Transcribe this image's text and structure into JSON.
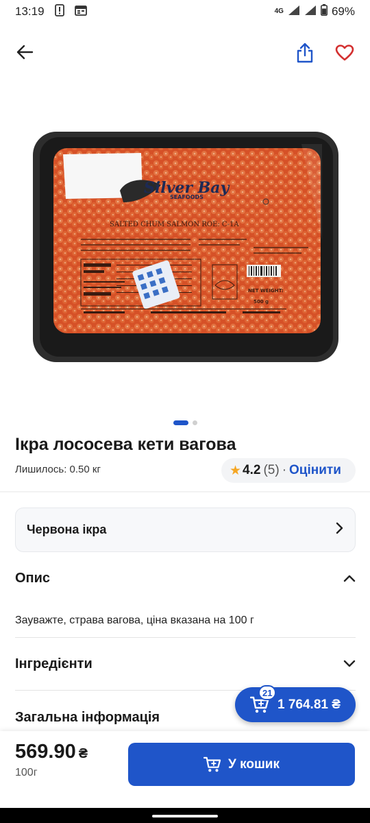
{
  "status_bar": {
    "time": "13:19",
    "network": "4G",
    "battery": "69%"
  },
  "product": {
    "title": "Ікра лососева кети вагова",
    "remaining": "Лишилось: 0.50 кг",
    "rating_score": "4.2",
    "rating_count": "(5)",
    "rating_sep": "·",
    "rate_label": "Оцінити",
    "image_slides": 2,
    "active_slide": 1
  },
  "package_label": {
    "brand": "Silver Bay",
    "brand_sub": "SEAFOODS",
    "product_line": "SALTED CHUM SALMON ROE: C-1A",
    "net_weight_label": "NET WEIGHT:",
    "net_weight": "500 g"
  },
  "category": {
    "label": "Червона ікра"
  },
  "sections": {
    "description_title": "Опис",
    "description_text": "Зауважте, страва вагова, ціна вказана на 100 г",
    "ingredients_title": "Інгредієнти",
    "general_info_title": "Загальна інформація"
  },
  "cart": {
    "badge": "21",
    "total": "1 764.81 ₴"
  },
  "purchase": {
    "price": "569.90",
    "currency": "₴",
    "unit": "100г",
    "add_label": "У кошик"
  },
  "colors": {
    "accent": "#1f55c9",
    "favorite": "#d32f2f",
    "star": "#f5a623"
  },
  "icons": [
    "back-arrow-icon",
    "share-icon",
    "heart-icon",
    "star-icon",
    "chevron-right-icon",
    "chevron-up-icon",
    "chevron-down-icon",
    "cart-icon",
    "cart-plus-icon"
  ]
}
